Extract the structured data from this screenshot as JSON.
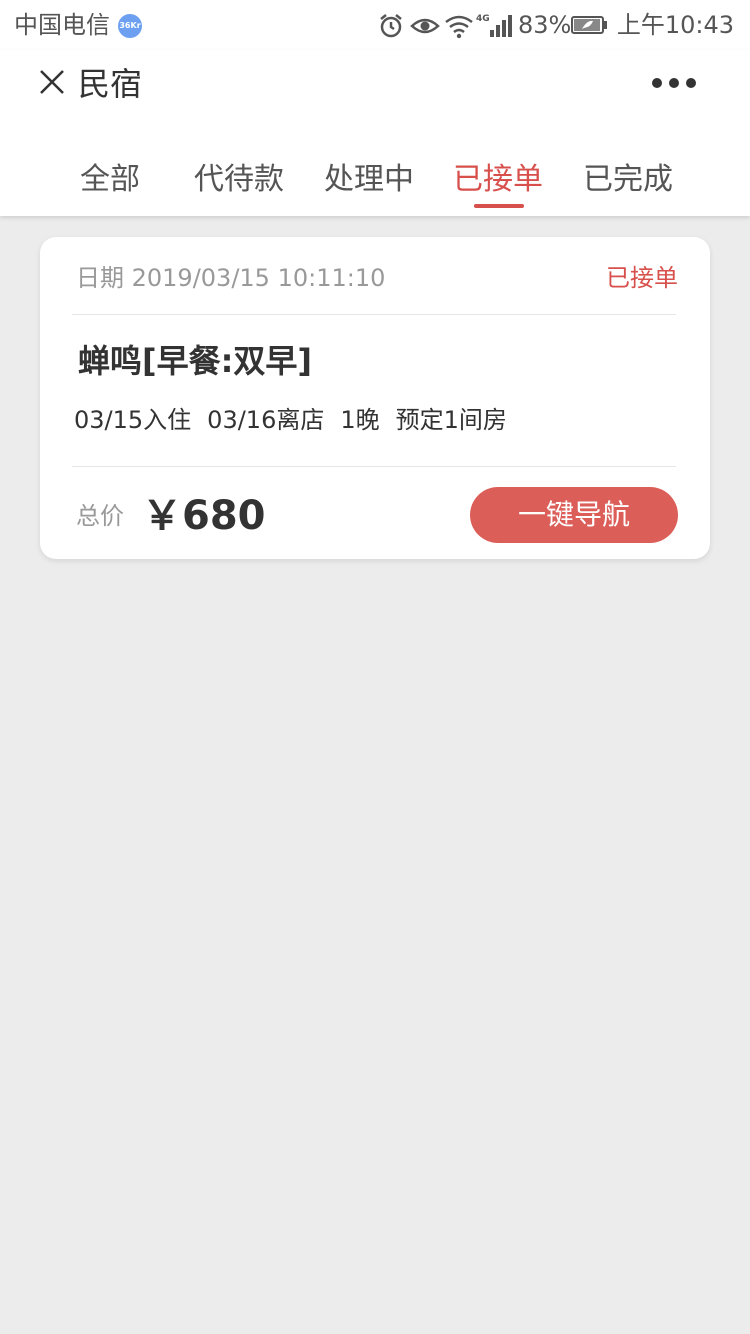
{
  "status_bar": {
    "carrier": "中国电信",
    "badge": "36Kr",
    "network": "4G",
    "battery": "83%",
    "time": "上午10:43"
  },
  "header": {
    "title": "民宿",
    "close_icon": "close-icon",
    "more_icon": "more-dots-icon"
  },
  "tabs": [
    {
      "label": "全部",
      "active": false
    },
    {
      "label": "代待款",
      "active": false
    },
    {
      "label": "处理中",
      "active": false
    },
    {
      "label": "已接单",
      "active": true
    },
    {
      "label": "已完成",
      "active": false
    }
  ],
  "orders": [
    {
      "date": "日期 2019/03/15 10:11:10",
      "status": "已接单",
      "title": "蝉鸣[早餐:双早]",
      "check_in": "03/15入住",
      "check_out": "03/16离店",
      "nights": "1晚",
      "rooms": "预定1间房",
      "price_label": "总价",
      "price": "￥680",
      "action_label": "一键导航"
    }
  ],
  "colors": {
    "accent": "#d7504c",
    "button": "#dc5e58",
    "background": "#ececec"
  }
}
